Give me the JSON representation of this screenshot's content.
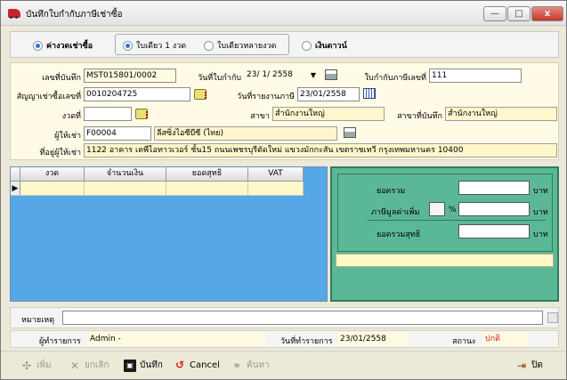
{
  "window": {
    "title": "บันทึกใบกำกับภาษีเช่าซื้อ",
    "minimize_glyph": "—",
    "maximize_glyph": "□",
    "close_glyph": "x"
  },
  "mode": {
    "options": [
      {
        "label": "ค่างวดเช่าซื้อ",
        "selected": true
      },
      {
        "label": "เงินดาวน์",
        "selected": false
      }
    ],
    "invoice_type": [
      {
        "label": "ใบเดียว 1 งวด",
        "selected": true
      },
      {
        "label": "ใบเดียวหลายงวด",
        "selected": false
      }
    ]
  },
  "form": {
    "record_no_label": "เลขที่บันทึก",
    "record_no": "MST015801/0002",
    "invoice_date_label": "วันที่ใบกำกับ",
    "invoice_date": "23/ 1/ 2558",
    "tax_invoice_no_label": "ใบกำกับภาษีเลขที่",
    "tax_invoice_no": "111",
    "contract_no_label": "สัญญาเช่าซื้อเลขที่",
    "contract_no": "0010204725",
    "report_date_label": "วันที่รายงานภาษี",
    "report_date": "23/01/2558",
    "installment_label": "งวดที่",
    "installment": "",
    "branch_label": "สาขา",
    "branch": "สำนักงานใหญ่",
    "record_branch_label": "สาขาที่บันทึก",
    "record_branch": "สำนักงานใหญ่",
    "lessee_label": "ผู้ให้เช่า",
    "lessee_code": "F00004",
    "lessee_name": "ลีสซิ่งไอซีบีซี (ไทย)",
    "address_label": "ที่อยู่ผู้ให้เช่า",
    "address": "1122  อาคาร เคพีไอทาวเวอร์ ชั้น15 ถนนเพชรบุรีตัดใหม่ แขวงมักกะสัน เขตราชเทวี กรุงเทพมหานคร 10400"
  },
  "grid": {
    "columns": [
      "งวด",
      "จำนวนเงิน",
      "ยอดสุทธิ",
      "VAT"
    ],
    "row_indicator": "▶"
  },
  "summary": {
    "total_label": "ยอดรวม",
    "vat_label": "ภาษีมูลค่าเพิ่ม",
    "percent_symbol": "%",
    "net_label": "ยอดรวมสุทธิ",
    "unit": "บาท",
    "total": "",
    "vat_rate": "",
    "vat": "",
    "net": ""
  },
  "remarks": {
    "label": "หมายเหตุ",
    "value": ""
  },
  "status": {
    "operator_label": "ผู้ทำรายการ",
    "operator": "Admin -",
    "date_label": "วันที่ทำรายการ",
    "date": "23/01/2558",
    "state_label": "สถานะ",
    "state": "ปกติ",
    "state_color": "#d21f1f"
  },
  "toolbar": {
    "add": "เพิ่ม",
    "cancel_doc": "ยกเลิก",
    "save": "บันทึก",
    "cancel": "Cancel",
    "search": "ค้นหา",
    "close": "ปิด"
  },
  "colors": {
    "form_bg": "#fffbe6",
    "grid_bg": "#55a7e6",
    "summary_bg": "#5bb896"
  }
}
